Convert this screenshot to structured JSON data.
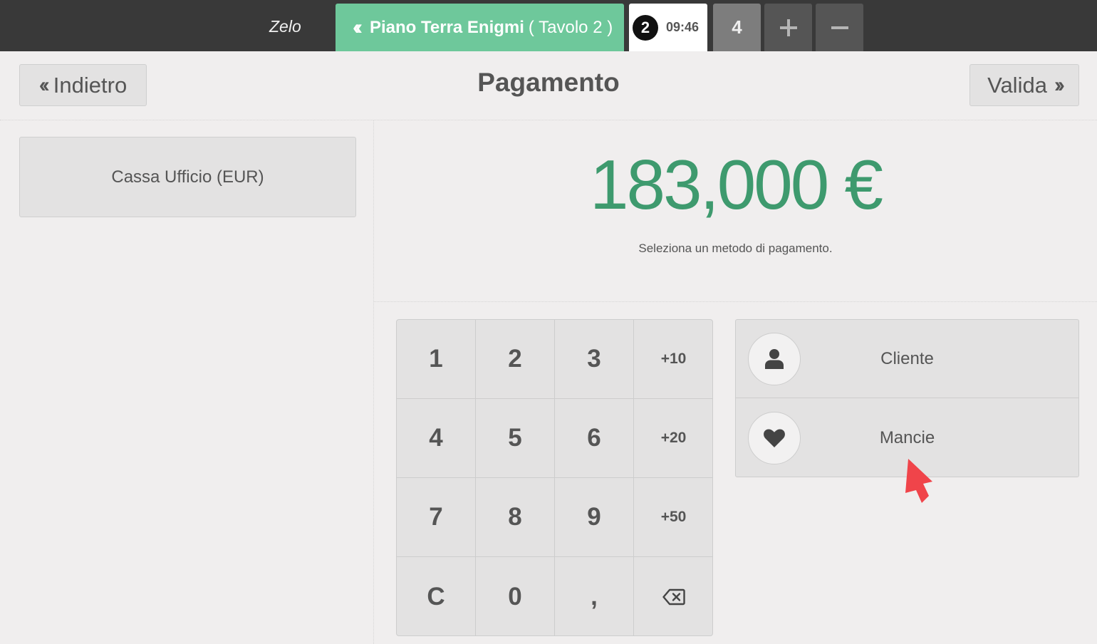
{
  "topbar": {
    "brand": "Zelo",
    "order_title": "Piano Terra Enigmi",
    "order_sub": "( Tavolo 2 )",
    "tab_number": "2",
    "tab_time": "09:46",
    "count": "4"
  },
  "header": {
    "back_label": "Indietro",
    "title": "Pagamento",
    "next_label": "Valida"
  },
  "payment_methods": [
    {
      "label": "Cassa Ufficio (EUR)"
    }
  ],
  "amount": {
    "total": "183,000 €",
    "hint": "Seleziona un metodo di pagamento."
  },
  "numpad": {
    "keys": [
      "1",
      "2",
      "3",
      "+10",
      "4",
      "5",
      "6",
      "+20",
      "7",
      "8",
      "9",
      "+50",
      "C",
      "0",
      ",",
      "backspace"
    ]
  },
  "side": {
    "customer_label": "Cliente",
    "tips_label": "Mancie"
  },
  "colors": {
    "accent_green": "#6ec89b",
    "amount_green": "#3e9a6e",
    "topbar_bg": "#393939",
    "cursor_red": "#f0444a"
  },
  "icons": [
    "double-chevron-left-icon",
    "plus-icon",
    "minus-icon",
    "double-chevron-right-icon",
    "backspace-icon",
    "user-icon",
    "heart-icon",
    "mouse-cursor-icon"
  ]
}
